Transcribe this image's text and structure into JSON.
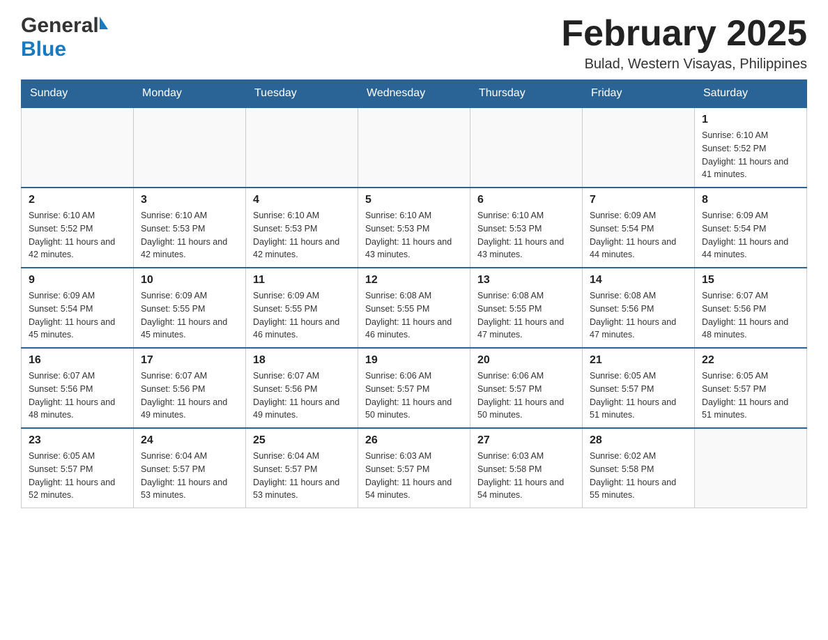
{
  "header": {
    "logo_general": "General",
    "logo_blue": "Blue",
    "title": "February 2025",
    "location": "Bulad, Western Visayas, Philippines"
  },
  "columns": [
    "Sunday",
    "Monday",
    "Tuesday",
    "Wednesday",
    "Thursday",
    "Friday",
    "Saturday"
  ],
  "weeks": [
    {
      "days": [
        {
          "num": "",
          "info": ""
        },
        {
          "num": "",
          "info": ""
        },
        {
          "num": "",
          "info": ""
        },
        {
          "num": "",
          "info": ""
        },
        {
          "num": "",
          "info": ""
        },
        {
          "num": "",
          "info": ""
        },
        {
          "num": "1",
          "info": "Sunrise: 6:10 AM\nSunset: 5:52 PM\nDaylight: 11 hours\nand 41 minutes."
        }
      ]
    },
    {
      "days": [
        {
          "num": "2",
          "info": "Sunrise: 6:10 AM\nSunset: 5:52 PM\nDaylight: 11 hours\nand 42 minutes."
        },
        {
          "num": "3",
          "info": "Sunrise: 6:10 AM\nSunset: 5:53 PM\nDaylight: 11 hours\nand 42 minutes."
        },
        {
          "num": "4",
          "info": "Sunrise: 6:10 AM\nSunset: 5:53 PM\nDaylight: 11 hours\nand 42 minutes."
        },
        {
          "num": "5",
          "info": "Sunrise: 6:10 AM\nSunset: 5:53 PM\nDaylight: 11 hours\nand 43 minutes."
        },
        {
          "num": "6",
          "info": "Sunrise: 6:10 AM\nSunset: 5:53 PM\nDaylight: 11 hours\nand 43 minutes."
        },
        {
          "num": "7",
          "info": "Sunrise: 6:09 AM\nSunset: 5:54 PM\nDaylight: 11 hours\nand 44 minutes."
        },
        {
          "num": "8",
          "info": "Sunrise: 6:09 AM\nSunset: 5:54 PM\nDaylight: 11 hours\nand 44 minutes."
        }
      ]
    },
    {
      "days": [
        {
          "num": "9",
          "info": "Sunrise: 6:09 AM\nSunset: 5:54 PM\nDaylight: 11 hours\nand 45 minutes."
        },
        {
          "num": "10",
          "info": "Sunrise: 6:09 AM\nSunset: 5:55 PM\nDaylight: 11 hours\nand 45 minutes."
        },
        {
          "num": "11",
          "info": "Sunrise: 6:09 AM\nSunset: 5:55 PM\nDaylight: 11 hours\nand 46 minutes."
        },
        {
          "num": "12",
          "info": "Sunrise: 6:08 AM\nSunset: 5:55 PM\nDaylight: 11 hours\nand 46 minutes."
        },
        {
          "num": "13",
          "info": "Sunrise: 6:08 AM\nSunset: 5:55 PM\nDaylight: 11 hours\nand 47 minutes."
        },
        {
          "num": "14",
          "info": "Sunrise: 6:08 AM\nSunset: 5:56 PM\nDaylight: 11 hours\nand 47 minutes."
        },
        {
          "num": "15",
          "info": "Sunrise: 6:07 AM\nSunset: 5:56 PM\nDaylight: 11 hours\nand 48 minutes."
        }
      ]
    },
    {
      "days": [
        {
          "num": "16",
          "info": "Sunrise: 6:07 AM\nSunset: 5:56 PM\nDaylight: 11 hours\nand 48 minutes."
        },
        {
          "num": "17",
          "info": "Sunrise: 6:07 AM\nSunset: 5:56 PM\nDaylight: 11 hours\nand 49 minutes."
        },
        {
          "num": "18",
          "info": "Sunrise: 6:07 AM\nSunset: 5:56 PM\nDaylight: 11 hours\nand 49 minutes."
        },
        {
          "num": "19",
          "info": "Sunrise: 6:06 AM\nSunset: 5:57 PM\nDaylight: 11 hours\nand 50 minutes."
        },
        {
          "num": "20",
          "info": "Sunrise: 6:06 AM\nSunset: 5:57 PM\nDaylight: 11 hours\nand 50 minutes."
        },
        {
          "num": "21",
          "info": "Sunrise: 6:05 AM\nSunset: 5:57 PM\nDaylight: 11 hours\nand 51 minutes."
        },
        {
          "num": "22",
          "info": "Sunrise: 6:05 AM\nSunset: 5:57 PM\nDaylight: 11 hours\nand 51 minutes."
        }
      ]
    },
    {
      "days": [
        {
          "num": "23",
          "info": "Sunrise: 6:05 AM\nSunset: 5:57 PM\nDaylight: 11 hours\nand 52 minutes."
        },
        {
          "num": "24",
          "info": "Sunrise: 6:04 AM\nSunset: 5:57 PM\nDaylight: 11 hours\nand 53 minutes."
        },
        {
          "num": "25",
          "info": "Sunrise: 6:04 AM\nSunset: 5:57 PM\nDaylight: 11 hours\nand 53 minutes."
        },
        {
          "num": "26",
          "info": "Sunrise: 6:03 AM\nSunset: 5:57 PM\nDaylight: 11 hours\nand 54 minutes."
        },
        {
          "num": "27",
          "info": "Sunrise: 6:03 AM\nSunset: 5:58 PM\nDaylight: 11 hours\nand 54 minutes."
        },
        {
          "num": "28",
          "info": "Sunrise: 6:02 AM\nSunset: 5:58 PM\nDaylight: 11 hours\nand 55 minutes."
        },
        {
          "num": "",
          "info": ""
        }
      ]
    }
  ]
}
